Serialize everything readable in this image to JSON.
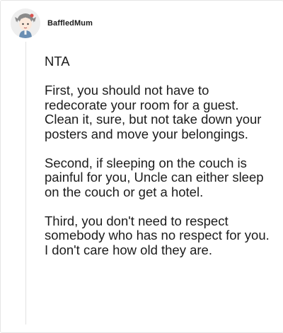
{
  "post": {
    "username": "BaffledMum",
    "avatar_icon": "cartoon-character-avatar-icon",
    "paragraphs": [
      "NTA",
      "First, you should not have to redecorate your room for a guest. Clean it, sure, but not take down your posters and move your belongings.",
      "Second, if sleeping on the couch is painful for you, Uncle can either sleep on the couch or get a hotel.",
      "Third, you don't need to respect somebody who has no respect for you. I don't care how old they are."
    ]
  },
  "colors": {
    "text": "#1c1c1c",
    "border": "#e6e6e6",
    "thread_line": "#e2e2e2",
    "background": "#ffffff"
  }
}
